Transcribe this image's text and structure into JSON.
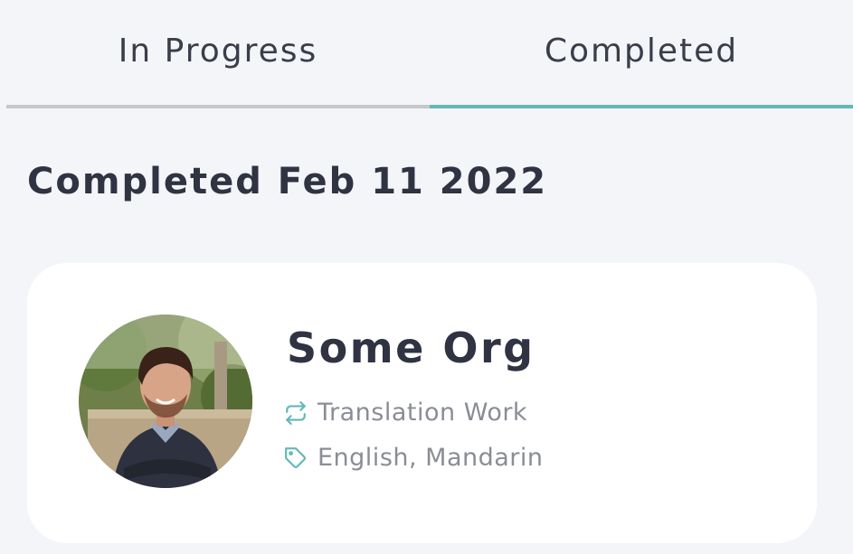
{
  "tabs": [
    {
      "label": "In Progress",
      "active": false
    },
    {
      "label": "Completed",
      "active": true
    }
  ],
  "section": {
    "title": "Completed Feb 11 2022"
  },
  "card": {
    "org_name": "Some Org",
    "service_icon": "repeat-icon",
    "service": "Translation Work",
    "tags_icon": "tag-icon",
    "languages": "English, Mandarin"
  },
  "colors": {
    "background": "#f4f5f9",
    "accent": "#64b8b6",
    "inactive_underline": "#c6c7cb",
    "card": "#ffffff",
    "text_dark": "#2f3342",
    "text_muted": "#8a8d96"
  }
}
